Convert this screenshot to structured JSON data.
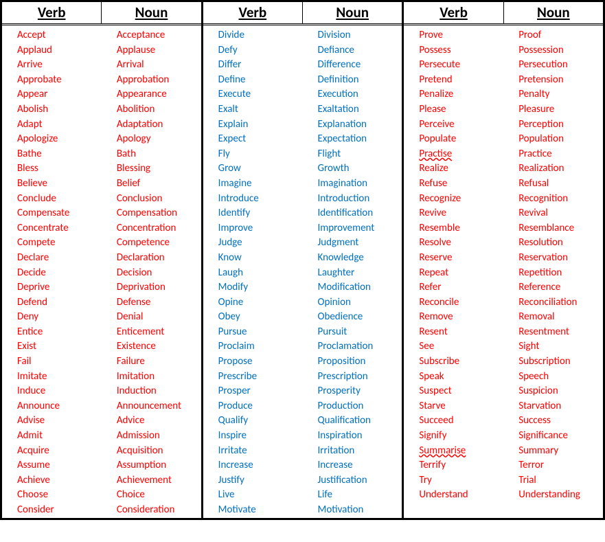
{
  "headers": {
    "verb": "Verb",
    "noun": "Noun"
  },
  "blocks": [
    {
      "color": "red",
      "rows": [
        {
          "verb": "Accept",
          "noun": "Acceptance"
        },
        {
          "verb": "Applaud",
          "noun": "Applause"
        },
        {
          "verb": "Arrive",
          "noun": "Arrival"
        },
        {
          "verb": "Approbate",
          "noun": "Approbation"
        },
        {
          "verb": "Appear",
          "noun": "Appearance"
        },
        {
          "verb": "Abolish",
          "noun": "Abolition"
        },
        {
          "verb": "Adapt",
          "noun": "Adaptation"
        },
        {
          "verb": "Apologize",
          "noun": "Apology"
        },
        {
          "verb": "Bathe",
          "noun": "Bath"
        },
        {
          "verb": "Bless",
          "noun": "Blessing"
        },
        {
          "verb": "Believe",
          "noun": "Belief"
        },
        {
          "verb": "Conclude",
          "noun": "Conclusion"
        },
        {
          "verb": "Compensate",
          "noun": "Compensation"
        },
        {
          "verb": "Concentrate",
          "noun": "Concentration"
        },
        {
          "verb": "Compete",
          "noun": "Competence"
        },
        {
          "verb": "Declare",
          "noun": "Declaration"
        },
        {
          "verb": "Decide",
          "noun": "Decision"
        },
        {
          "verb": "Deprive",
          "noun": "Deprivation"
        },
        {
          "verb": "Defend",
          "noun": "Defense"
        },
        {
          "verb": "Deny",
          "noun": "Denial"
        },
        {
          "verb": "Entice",
          "noun": "Enticement"
        },
        {
          "verb": "Exist",
          "noun": "Existence"
        },
        {
          "verb": "Fail",
          "noun": "Failure"
        },
        {
          "verb": "Imitate",
          "noun": "Imitation"
        },
        {
          "verb": "Induce",
          "noun": "Induction"
        },
        {
          "verb": "Announce",
          "noun": "Announcement"
        },
        {
          "verb": "Advise",
          "noun": "Advice"
        },
        {
          "verb": "Admit",
          "noun": "Admission"
        },
        {
          "verb": "Acquire",
          "noun": "Acquisition"
        },
        {
          "verb": "Assume",
          "noun": "Assumption"
        },
        {
          "verb": "Achieve",
          "noun": "Achievement"
        },
        {
          "verb": "Choose",
          "noun": "Choice"
        },
        {
          "verb": "Consider",
          "noun": "Consideration"
        }
      ]
    },
    {
      "color": "blue",
      "rows": [
        {
          "verb": "Divide",
          "noun": "Division"
        },
        {
          "verb": "Defy",
          "noun": "Defiance"
        },
        {
          "verb": "Differ",
          "noun": "Difference"
        },
        {
          "verb": "Define",
          "noun": "Definition"
        },
        {
          "verb": "Execute",
          "noun": "Execution"
        },
        {
          "verb": "Exalt",
          "noun": "Exaltation"
        },
        {
          "verb": "Explain",
          "noun": "Explanation"
        },
        {
          "verb": "Expect",
          "noun": "Expectation"
        },
        {
          "verb": "Fly",
          "noun": "Flight"
        },
        {
          "verb": "Grow",
          "noun": "Growth"
        },
        {
          "verb": "Imagine",
          "noun": "Imagination"
        },
        {
          "verb": "Introduce",
          "noun": "Introduction"
        },
        {
          "verb": "Identify",
          "noun": "Identification"
        },
        {
          "verb": "Improve",
          "noun": "Improvement"
        },
        {
          "verb": "Judge",
          "noun": "Judgment"
        },
        {
          "verb": "Know",
          "noun": "Knowledge"
        },
        {
          "verb": "Laugh",
          "noun": "Laughter"
        },
        {
          "verb": "Modify",
          "noun": "Modification"
        },
        {
          "verb": "Opine",
          "noun": "Opinion"
        },
        {
          "verb": "Obey",
          "noun": "Obedience"
        },
        {
          "verb": "Pursue",
          "noun": "Pursuit"
        },
        {
          "verb": "Proclaim",
          "noun": "Proclamation"
        },
        {
          "verb": "Propose",
          "noun": "Proposition"
        },
        {
          "verb": "Prescribe",
          "noun": "Prescription"
        },
        {
          "verb": "Prosper",
          "noun": "Prosperity"
        },
        {
          "verb": "Produce",
          "noun": "Production"
        },
        {
          "verb": "Qualify",
          "noun": "Qualification"
        },
        {
          "verb": "Inspire",
          "noun": "Inspiration"
        },
        {
          "verb": "Irritate",
          "noun": "Irritation"
        },
        {
          "verb": "Increase",
          "noun": "Increase"
        },
        {
          "verb": "Justify",
          "noun": "Justification"
        },
        {
          "verb": "Live",
          "noun": "Life"
        },
        {
          "verb": "Motivate",
          "noun": "Motivation"
        }
      ]
    },
    {
      "color": "red",
      "rows": [
        {
          "verb": "Prove",
          "noun": "Proof"
        },
        {
          "verb": "Possess",
          "noun": "Possession"
        },
        {
          "verb": "Persecute",
          "noun": "Persecution"
        },
        {
          "verb": "Pretend",
          "noun": "Pretension"
        },
        {
          "verb": "Penalize",
          "noun": "Penalty"
        },
        {
          "verb": "Please",
          "noun": "Pleasure"
        },
        {
          "verb": "Perceive",
          "noun": "Perception"
        },
        {
          "verb": "Populate",
          "noun": "Population"
        },
        {
          "verb": "Practise",
          "noun": "Practice",
          "verb_squiggle": true
        },
        {
          "verb": "Realize",
          "noun": "Realization"
        },
        {
          "verb": "Refuse",
          "noun": "Refusal"
        },
        {
          "verb": "Recognize",
          "noun": "Recognition"
        },
        {
          "verb": "Revive",
          "noun": "Revival"
        },
        {
          "verb": "Resemble",
          "noun": "Resemblance"
        },
        {
          "verb": "Resolve",
          "noun": "Resolution"
        },
        {
          "verb": "Reserve",
          "noun": "Reservation"
        },
        {
          "verb": "Repeat",
          "noun": "Repetition"
        },
        {
          "verb": "Refer",
          "noun": "Reference"
        },
        {
          "verb": "Reconcile",
          "noun": "Reconciliation"
        },
        {
          "verb": "Remove",
          "noun": "Removal"
        },
        {
          "verb": "Resent",
          "noun": "Resentment"
        },
        {
          "verb": "See",
          "noun": "Sight"
        },
        {
          "verb": "Subscribe",
          "noun": "Subscription"
        },
        {
          "verb": "Speak",
          "noun": "Speech"
        },
        {
          "verb": "Suspect",
          "noun": "Suspicion"
        },
        {
          "verb": "Starve",
          "noun": "Starvation"
        },
        {
          "verb": "Succeed",
          "noun": "Success"
        },
        {
          "verb": "Signify",
          "noun": "Significance"
        },
        {
          "verb": "Summarise",
          "noun": "Summary",
          "verb_squiggle": true
        },
        {
          "verb": "Terrify",
          "noun": "Terror"
        },
        {
          "verb": "Try",
          "noun": "Trial"
        },
        {
          "verb": "Understand",
          "noun": "Understanding"
        }
      ]
    }
  ]
}
